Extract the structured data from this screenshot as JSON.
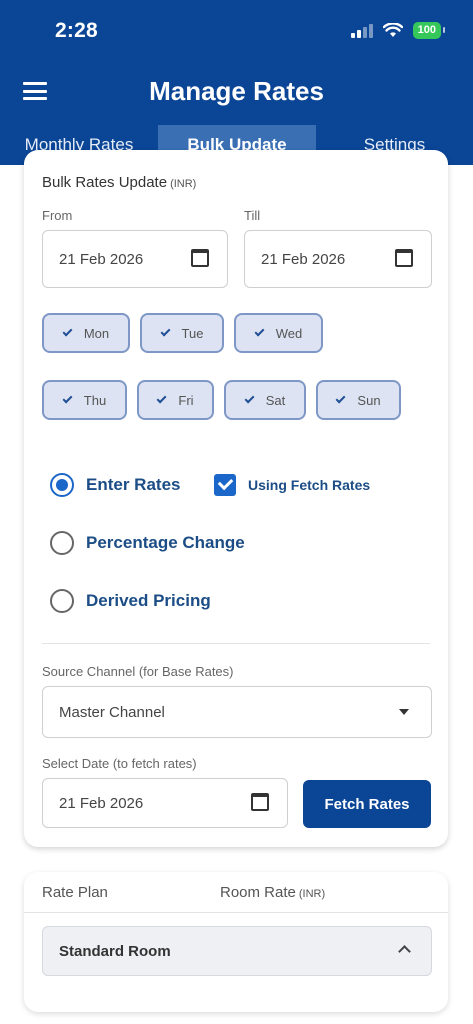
{
  "status_bar": {
    "time": "2:28",
    "battery": "100"
  },
  "header": {
    "title": "Manage Rates"
  },
  "tabs": [
    {
      "label": "Monthly Rates",
      "active": false
    },
    {
      "label": "Bulk Update",
      "active": true
    },
    {
      "label": "Settings",
      "active": false
    }
  ],
  "bulk": {
    "title": "Bulk Rates Update",
    "currency": "(INR)",
    "from_label": "From",
    "from_value": "21 Feb 2026",
    "till_label": "Till",
    "till_value": "21 Feb 2026",
    "days": [
      {
        "label": "Mon",
        "checked": true
      },
      {
        "label": "Tue",
        "checked": true
      },
      {
        "label": "Wed",
        "checked": true
      },
      {
        "label": "Thu",
        "checked": true
      },
      {
        "label": "Fri",
        "checked": true
      },
      {
        "label": "Sat",
        "checked": true
      },
      {
        "label": "Sun",
        "checked": true
      }
    ],
    "options": [
      {
        "label": "Enter Rates",
        "selected": true
      },
      {
        "label": "Percentage Change",
        "selected": false
      },
      {
        "label": "Derived Pricing",
        "selected": false
      }
    ],
    "fetch_checkbox": {
      "label": "Using Fetch Rates",
      "checked": true
    },
    "source_channel_label": "Source Channel (for Base Rates)",
    "source_channel_value": "Master Channel",
    "select_date_label": "Select Date (to fetch rates)",
    "select_date_value": "21 Feb 2026",
    "fetch_button": "Fetch Rates"
  },
  "rate_table": {
    "col_plan": "Rate Plan",
    "col_rate": "Room Rate",
    "col_rate_unit": "(INR)",
    "rows": [
      {
        "label": "Standard Room"
      }
    ]
  },
  "colors": {
    "primary": "#0b4596",
    "tab_active": "#3a6fb4",
    "accent": "#1b66c9",
    "battery": "#35c759"
  }
}
